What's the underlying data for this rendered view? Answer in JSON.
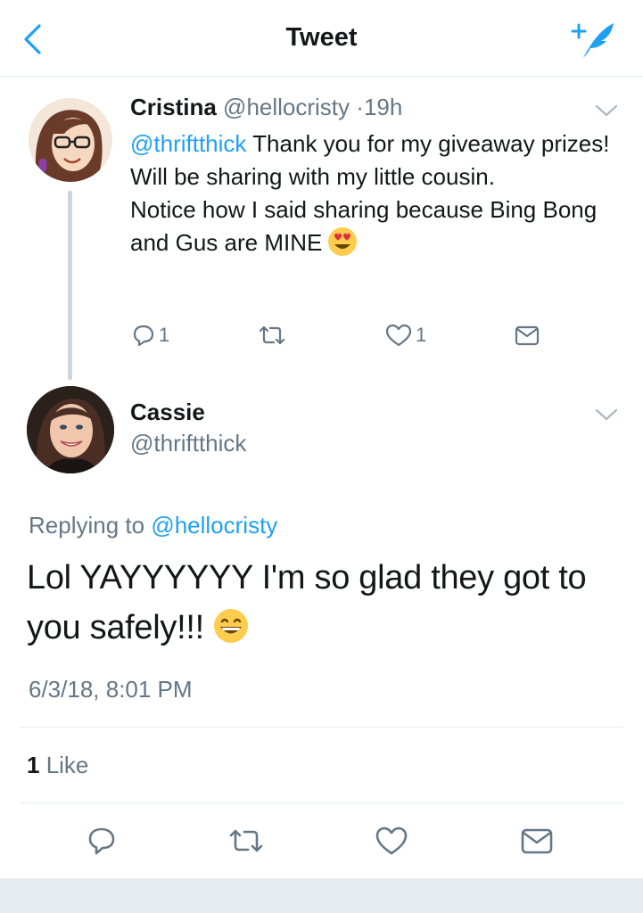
{
  "header": {
    "title": "Tweet"
  },
  "parent_tweet": {
    "name": "Cristina",
    "handle": "@hellocristy",
    "separator": "·",
    "time_ago": "19h",
    "mention": "@thriftthick",
    "text_line1": " Thank you for my giveaway prizes! Will be sharing with my little cousin.",
    "text_line2": "Notice how I said sharing because Bing Bong and Gus are MINE",
    "emoji": "heart-eyes-emoji",
    "reply_count": "1",
    "like_count": "1"
  },
  "main_tweet": {
    "name": "Cassie",
    "handle": "@thriftthick",
    "replying_prefix": "Replying to ",
    "replying_to": "@hellocristy",
    "text": "Lol YAYYYYYY I'm so glad they got to you safely!!!",
    "emoji": "grinning-emoji",
    "timestamp": "6/3/18, 8:01 PM",
    "like_count": "1",
    "like_label": " Like"
  },
  "colors": {
    "accent": "#1da1f2",
    "muted": "#657786",
    "text": "#14171a",
    "border": "#e6ecf0"
  },
  "icons": [
    "chevron-left-icon",
    "compose-tweet-icon",
    "chevron-down-icon",
    "reply-icon",
    "retweet-icon",
    "like-icon",
    "direct-message-icon"
  ]
}
